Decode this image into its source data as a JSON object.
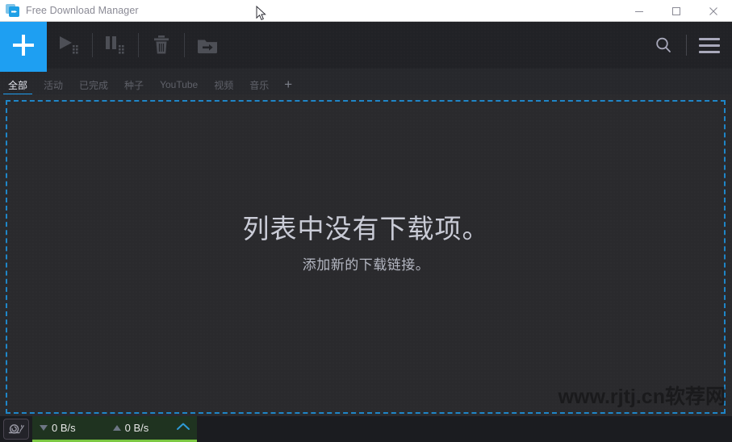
{
  "window": {
    "title": "Free Download Manager",
    "app_icon": "download-arrow-icon",
    "minimize_label": "—",
    "maximize_label": "□",
    "close_label": "✕"
  },
  "toolbar": {
    "add_label": "+",
    "add_name": "add-download-button",
    "buttons": [
      {
        "name": "start-all-button",
        "icon": "play-all-icon",
        "label": ""
      },
      {
        "name": "pause-all-button",
        "icon": "pause-all-icon",
        "label": ""
      },
      {
        "name": "delete-button",
        "icon": "trash-icon",
        "label": ""
      },
      {
        "name": "move-files-button",
        "icon": "move-to-folder-icon",
        "label": ""
      }
    ],
    "search_icon": "search-icon",
    "menu_icon": "hamburger-menu-icon"
  },
  "tabs": {
    "items": [
      {
        "label": "全部",
        "active": true
      },
      {
        "label": "活动",
        "active": false
      },
      {
        "label": "已完成",
        "active": false
      },
      {
        "label": "种子",
        "active": false
      },
      {
        "label": "YouTube",
        "active": false
      },
      {
        "label": "视频",
        "active": false
      },
      {
        "label": "音乐",
        "active": false
      }
    ],
    "add_tab_label": "+"
  },
  "content": {
    "empty_title": "列表中没有下载项。",
    "empty_subtitle": "添加新的下载链接。",
    "watermark": "www.rjtj.cn软荐网",
    "dropzone_border_color": "#1f86c8"
  },
  "status": {
    "speed_limit_icon": "snail-icon",
    "download_speed": "0 B/s",
    "upload_speed": "0 B/s",
    "expand_icon": "chevron-up-icon",
    "panel_accent_color": "#7cc843"
  },
  "colors": {
    "accent": "#1e9ff2",
    "toolbar_bg": "#212226",
    "content_bg": "#2a2a2d",
    "statusbar_bg": "#1b1c20"
  }
}
